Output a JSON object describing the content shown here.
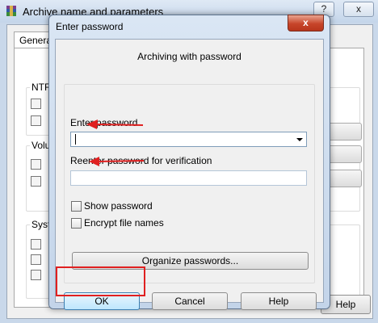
{
  "background_window": {
    "title": "Archive name and parameters",
    "help_glyph": "?",
    "close_glyph": "x",
    "tab_label": "General",
    "group_labels": [
      "NTF",
      "Volu",
      "Syst"
    ],
    "help_button_label": "Help"
  },
  "dialog": {
    "title": "Enter password",
    "close_glyph": "x",
    "heading": "Archiving with password",
    "enter_label": "Enter password",
    "enter_value": "",
    "reenter_label": "Reenter password for verification",
    "reenter_value": "",
    "show_password_label": "Show password",
    "show_password_checked": false,
    "encrypt_names_label": "Encrypt file names",
    "encrypt_names_checked": false,
    "organize_label": "Organize passwords...",
    "ok_label": "OK",
    "cancel_label": "Cancel",
    "help_label": "Help"
  },
  "annotations": {
    "color": "#e02020"
  }
}
